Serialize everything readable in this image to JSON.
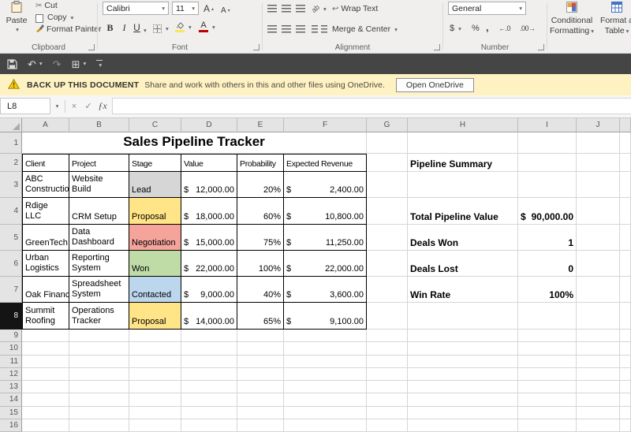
{
  "icons": {
    "dropdown": "▾",
    "cut": "✂",
    "undo": "↶",
    "redo": "↷",
    "grid": "⊞",
    "close": "×",
    "check": "✓",
    "fx": "ƒx",
    "wrap": "↩",
    "orientation": "ab"
  },
  "ribbon": {
    "paste_label": "Paste",
    "cut_label": "Cut",
    "copy_label": "Copy",
    "format_painter_label": "Format Painter",
    "clipboard_group": "Clipboard",
    "font_name": "Calibri",
    "font_size": "11",
    "bold_label": "B",
    "italic_label": "I",
    "underline_label": "U",
    "grow_font_label": "A",
    "shrink_font_label": "A",
    "font_color_label": "A",
    "font_color_hex": "#c00000",
    "fill_color_hex": "#ffe35b",
    "font_group": "Font",
    "wrap_text_label": "Wrap Text",
    "merge_center_label": "Merge & Center",
    "alignment_group": "Alignment",
    "number_format": "General",
    "currency_label": "$",
    "percent_label": "%",
    "comma_label": ",",
    "increase_decimal_label": "←.0",
    "decrease_decimal_label": ".00→",
    "number_group": "Number",
    "conditional_line1": "Conditional",
    "conditional_line2": "Formatting",
    "format_table_line1": "Format a",
    "format_table_line2": "Table"
  },
  "notification": {
    "title": "BACK UP THIS DOCUMENT",
    "message": "Share and work with others in this and other files using OneDrive.",
    "button_label": "Open OneDrive"
  },
  "formula_bar": {
    "name_box": "L8",
    "formula_value": ""
  },
  "sheet": {
    "columns": [
      "A",
      "B",
      "C",
      "D",
      "E",
      "F",
      "G",
      "H",
      "I",
      "J"
    ],
    "rows": [
      "1",
      "2",
      "3",
      "4",
      "5",
      "6",
      "7",
      "8",
      "9",
      "10",
      "11",
      "12",
      "13",
      "14",
      "15",
      "16"
    ],
    "active_row": "8",
    "stage_colors": {
      "Lead": "#d6d6d6",
      "Proposal": "#ffe488",
      "Negotiation": "#f5a49c",
      "Won": "#bfdba6",
      "Contacted": "#bcd6ee"
    },
    "cells": [
      {
        "c": "A",
        "r": 1,
        "span": 6,
        "t": "Sales Pipeline Tracker",
        "cls": "title"
      },
      {
        "c": "A",
        "r": 2,
        "t": "Client",
        "cls": "tb bt bl hdr"
      },
      {
        "c": "B",
        "r": 2,
        "t": "Project",
        "cls": "tb bt hdr"
      },
      {
        "c": "C",
        "r": 2,
        "t": "Stage",
        "cls": "tb bt hdr"
      },
      {
        "c": "D",
        "r": 2,
        "t": "Value",
        "cls": "tb bt hdr"
      },
      {
        "c": "E",
        "r": 2,
        "t": "Probability",
        "cls": "tb bt hdr"
      },
      {
        "c": "F",
        "r": 2,
        "t": "Expected Revenue",
        "cls": "tb bt hdr"
      },
      {
        "c": "A",
        "r": 3,
        "t": "ABC\nConstruction",
        "cls": "tb bl wrap"
      },
      {
        "c": "B",
        "r": 3,
        "t": "Website\nBuild",
        "cls": "tb wrap"
      },
      {
        "c": "C",
        "r": 3,
        "t": "Lead",
        "cls": "tb",
        "fill": "#d6d6d6"
      },
      {
        "c": "D",
        "r": 3,
        "cur": "$",
        "t": "12,000.00",
        "cls": "tb money"
      },
      {
        "c": "E",
        "r": 3,
        "t": "20%",
        "cls": "tb right"
      },
      {
        "c": "F",
        "r": 3,
        "cur": "$",
        "t": "2,400.00",
        "cls": "tb money"
      },
      {
        "c": "A",
        "r": 4,
        "t": "North Rdige\nLLC",
        "cls": "tb bl wrap"
      },
      {
        "c": "B",
        "r": 4,
        "t": "CRM Setup",
        "cls": "tb"
      },
      {
        "c": "C",
        "r": 4,
        "t": "Proposal",
        "cls": "tb",
        "fill": "#ffe488"
      },
      {
        "c": "D",
        "r": 4,
        "cur": "$",
        "t": "18,000.00",
        "cls": "tb money"
      },
      {
        "c": "E",
        "r": 4,
        "t": "60%",
        "cls": "tb right"
      },
      {
        "c": "F",
        "r": 4,
        "cur": "$",
        "t": "10,800.00",
        "cls": "tb money"
      },
      {
        "c": "A",
        "r": 5,
        "t": "GreenTech",
        "cls": "tb bl"
      },
      {
        "c": "B",
        "r": 5,
        "t": "Data\nDashboard",
        "cls": "tb wrap"
      },
      {
        "c": "C",
        "r": 5,
        "t": "Negotiation",
        "cls": "tb",
        "fill": "#f5a49c"
      },
      {
        "c": "D",
        "r": 5,
        "cur": "$",
        "t": "15,000.00",
        "cls": "tb money"
      },
      {
        "c": "E",
        "r": 5,
        "t": "75%",
        "cls": "tb right"
      },
      {
        "c": "F",
        "r": 5,
        "cur": "$",
        "t": "11,250.00",
        "cls": "tb money"
      },
      {
        "c": "A",
        "r": 6,
        "t": "Urban\nLogistics",
        "cls": "tb bl wrap"
      },
      {
        "c": "B",
        "r": 6,
        "t": "Reporting\nSystem",
        "cls": "tb wrap"
      },
      {
        "c": "C",
        "r": 6,
        "t": "Won",
        "cls": "tb",
        "fill": "#bfdba6"
      },
      {
        "c": "D",
        "r": 6,
        "cur": "$",
        "t": "22,000.00",
        "cls": "tb money"
      },
      {
        "c": "E",
        "r": 6,
        "t": "100%",
        "cls": "tb right"
      },
      {
        "c": "F",
        "r": 6,
        "cur": "$",
        "t": "22,000.00",
        "cls": "tb money"
      },
      {
        "c": "A",
        "r": 7,
        "t": "Oak Financial",
        "cls": "tb bl"
      },
      {
        "c": "B",
        "r": 7,
        "t": "Spreadsheet\nSystem",
        "cls": "tb wrap"
      },
      {
        "c": "C",
        "r": 7,
        "t": "Contacted",
        "cls": "tb",
        "fill": "#bcd6ee"
      },
      {
        "c": "D",
        "r": 7,
        "cur": "$",
        "t": "9,000.00",
        "cls": "tb money"
      },
      {
        "c": "E",
        "r": 7,
        "t": "40%",
        "cls": "tb right"
      },
      {
        "c": "F",
        "r": 7,
        "cur": "$",
        "t": "3,600.00",
        "cls": "tb money"
      },
      {
        "c": "A",
        "r": 8,
        "t": "Summit\nRoofing",
        "cls": "tb bl wrap"
      },
      {
        "c": "B",
        "r": 8,
        "t": "Operations\nTracker",
        "cls": "tb wrap"
      },
      {
        "c": "C",
        "r": 8,
        "t": "Proposal",
        "cls": "tb",
        "fill": "#ffe488"
      },
      {
        "c": "D",
        "r": 8,
        "cur": "$",
        "t": "14,000.00",
        "cls": "tb money"
      },
      {
        "c": "E",
        "r": 8,
        "t": "65%",
        "cls": "tb right"
      },
      {
        "c": "F",
        "r": 8,
        "cur": "$",
        "t": "9,100.00",
        "cls": "tb money"
      },
      {
        "c": "H",
        "r": 2,
        "t": "Pipeline Summary",
        "cls": "bold s12"
      },
      {
        "c": "H",
        "r": 4,
        "t": "Total Pipeline Value",
        "cls": "bold s12"
      },
      {
        "c": "I",
        "r": 4,
        "cur": "$",
        "t": "90,000.00",
        "cls": "bold s12 money"
      },
      {
        "c": "H",
        "r": 5,
        "t": "Deals Won",
        "cls": "bold s12"
      },
      {
        "c": "I",
        "r": 5,
        "t": "1",
        "cls": "bold s12 right"
      },
      {
        "c": "H",
        "r": 6,
        "t": "Deals Lost",
        "cls": "bold s12"
      },
      {
        "c": "I",
        "r": 6,
        "t": "0",
        "cls": "bold s12 right"
      },
      {
        "c": "H",
        "r": 7,
        "t": "Win Rate",
        "cls": "bold s12"
      },
      {
        "c": "I",
        "r": 7,
        "t": "100%",
        "cls": "bold s12 right"
      }
    ]
  }
}
